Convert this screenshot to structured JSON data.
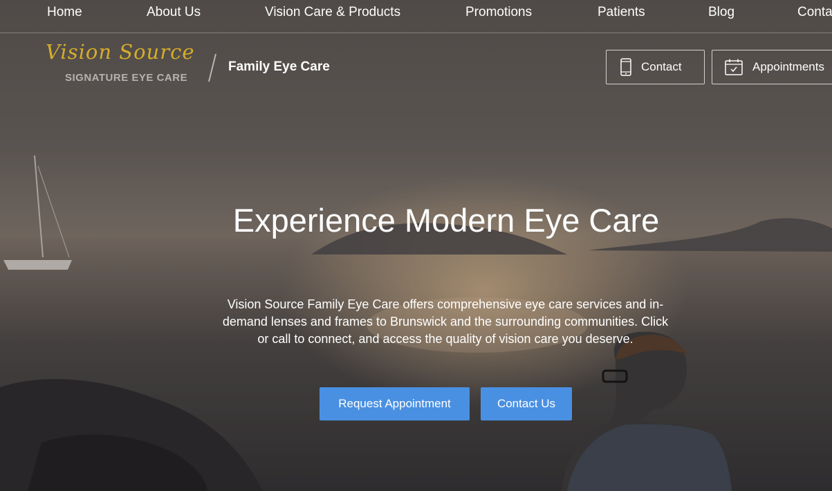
{
  "top_nav": {
    "items": [
      {
        "label": "Home"
      },
      {
        "label": "About Us"
      },
      {
        "label": "Vision Care & Products"
      },
      {
        "label": "Promotions"
      },
      {
        "label": "Patients"
      },
      {
        "label": "Blog"
      },
      {
        "label": "Conta"
      }
    ]
  },
  "header": {
    "logo_script": "Vision Source",
    "logo_sub": "SIGNATURE EYE CARE",
    "practice_name": "Family Eye Care",
    "contact_label": "Contact",
    "contact_icon": "phone-icon",
    "appointments_label": "Appointments",
    "appointments_icon": "calendar-icon"
  },
  "hero": {
    "title": "Experience Modern Eye Care",
    "description": "Vision Source Family Eye Care offers comprehensive eye care services and in-demand lenses and frames to Brunswick and the surrounding communities. Click or call to connect, and access the quality of vision care you deserve.",
    "primary_cta": "Request Appointment",
    "secondary_cta": "Contact Us"
  },
  "colors": {
    "accent": "#4a90e2",
    "logo_gold": "#d6ad2a"
  }
}
